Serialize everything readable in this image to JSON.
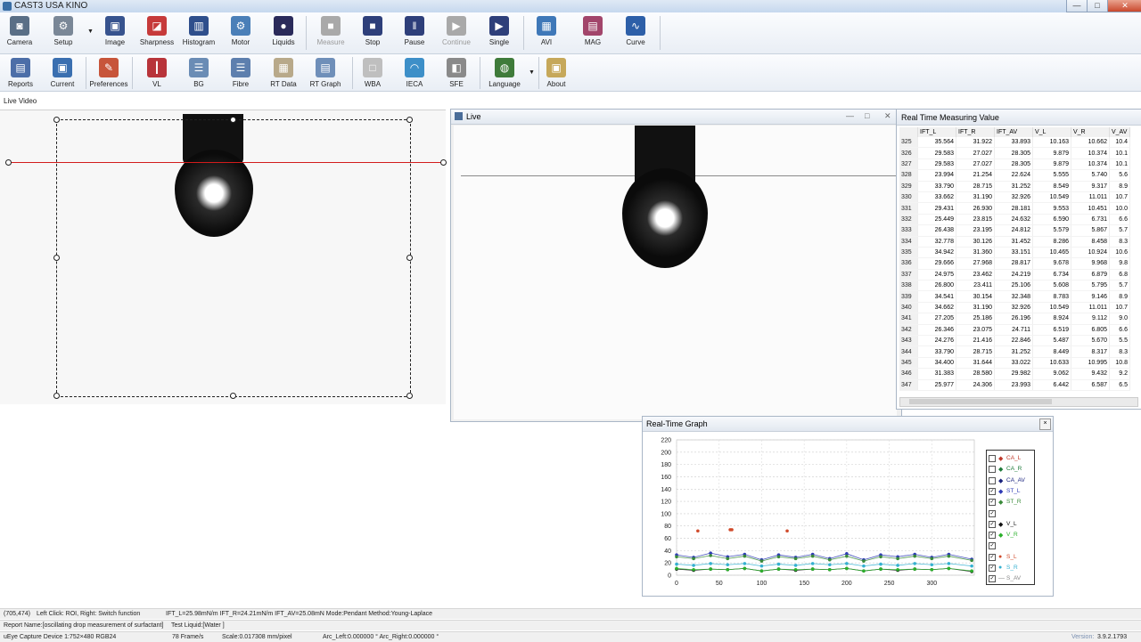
{
  "window": {
    "title": "CAST3  USA KINO",
    "controls": [
      "—",
      "□",
      "✕"
    ]
  },
  "toolbar1": {
    "items": [
      {
        "label": "Camera",
        "color": "#5a6f86",
        "glyph": "◙"
      },
      {
        "label": "Setup",
        "color": "#7a8797",
        "glyph": "⚙"
      },
      {
        "label": "Image",
        "color": "#37538e",
        "glyph": "▣"
      },
      {
        "label": "Sharpness",
        "color": "#c63a3a",
        "glyph": "◪"
      },
      {
        "label": "Histogram",
        "color": "#2f4f8c",
        "glyph": "▥"
      },
      {
        "label": "Motor",
        "color": "#4a7fb8",
        "glyph": "⚙"
      },
      {
        "label": "Liquids",
        "color": "#2a2a5a",
        "glyph": "●"
      },
      {
        "label": "Measure",
        "color": "#a9a9a9",
        "glyph": "■",
        "disabled": true
      },
      {
        "label": "Stop",
        "color": "#2e3f7a",
        "glyph": "■"
      },
      {
        "label": "Pause",
        "color": "#2e3f7a",
        "glyph": "‖"
      },
      {
        "label": "Continue",
        "color": "#a9a9a9",
        "glyph": "▶",
        "disabled": true
      },
      {
        "label": "Single",
        "color": "#2e3f7a",
        "glyph": "▶"
      },
      {
        "label": "AVI",
        "color": "#3f78b8",
        "glyph": "▦"
      },
      {
        "label": "MAG",
        "color": "#a2456b",
        "glyph": "▤"
      },
      {
        "label": "Curve",
        "color": "#2d5fa8",
        "glyph": "∿"
      }
    ]
  },
  "toolbar2": {
    "items": [
      {
        "label": "Reports",
        "color": "#4c6ea8",
        "glyph": "▤"
      },
      {
        "label": "Current",
        "color": "#3a6fb0",
        "glyph": "▣"
      },
      {
        "label": "Preferences",
        "color": "#c7553a",
        "glyph": "✎"
      },
      {
        "label": "VL",
        "color": "#b8343a",
        "glyph": "┃"
      },
      {
        "label": "BG",
        "color": "#6a8cb5",
        "glyph": "☰"
      },
      {
        "label": "Fibre",
        "color": "#5d7fae",
        "glyph": "☰"
      },
      {
        "label": "RT Data",
        "color": "#b8a98a",
        "glyph": "▦"
      },
      {
        "label": "RT Graph",
        "color": "#6f8fb9",
        "glyph": "▤"
      },
      {
        "label": "WBA",
        "color": "#bfbfbf",
        "glyph": "□"
      },
      {
        "label": "IECA",
        "color": "#3d8fc8",
        "glyph": "◠"
      },
      {
        "label": "SFE",
        "color": "#8a8a8a",
        "glyph": "◧"
      },
      {
        "label": "Language",
        "color": "#3f7b3a",
        "glyph": "◍"
      },
      {
        "label": "About",
        "color": "#c6a85a",
        "glyph": "▣"
      }
    ]
  },
  "live_video": {
    "label": "Live Video"
  },
  "live_window": {
    "title": "Live",
    "controls": [
      "—",
      "□",
      "✕"
    ]
  },
  "rt_table": {
    "title": "Real Time Measuring Value",
    "columns": [
      "",
      "IFT_L",
      "IFT_R",
      "IFT_AV",
      "V_L",
      "V_R",
      "V_AV"
    ],
    "rows": [
      [
        "325",
        "35.564",
        "31.922",
        "33.893",
        "10.163",
        "10.662",
        "10.4"
      ],
      [
        "326",
        "29.583",
        "27.027",
        "28.305",
        "9.879",
        "10.374",
        "10.1"
      ],
      [
        "327",
        "29.583",
        "27.027",
        "28.305",
        "9.879",
        "10.374",
        "10.1"
      ],
      [
        "328",
        "23.994",
        "21.254",
        "22.624",
        "5.555",
        "5.740",
        "5.6"
      ],
      [
        "329",
        "33.790",
        "28.715",
        "31.252",
        "8.549",
        "9.317",
        "8.9"
      ],
      [
        "330",
        "33.662",
        "31.190",
        "32.926",
        "10.549",
        "11.011",
        "10.7"
      ],
      [
        "331",
        "29.431",
        "26.930",
        "28.181",
        "9.553",
        "10.451",
        "10.0"
      ],
      [
        "332",
        "25.449",
        "23.815",
        "24.632",
        "6.590",
        "6.731",
        "6.6"
      ],
      [
        "333",
        "26.438",
        "23.195",
        "24.812",
        "5.579",
        "5.867",
        "5.7"
      ],
      [
        "334",
        "32.778",
        "30.126",
        "31.452",
        "8.286",
        "8.458",
        "8.3"
      ],
      [
        "335",
        "34.942",
        "31.360",
        "33.151",
        "10.465",
        "10.924",
        "10.6"
      ],
      [
        "336",
        "29.666",
        "27.968",
        "28.817",
        "9.678",
        "9.968",
        "9.8"
      ],
      [
        "337",
        "24.975",
        "23.462",
        "24.219",
        "6.734",
        "6.879",
        "6.8"
      ],
      [
        "338",
        "26.800",
        "23.411",
        "25.106",
        "5.608",
        "5.795",
        "5.7"
      ],
      [
        "339",
        "34.541",
        "30.154",
        "32.348",
        "8.783",
        "9.146",
        "8.9"
      ],
      [
        "340",
        "34.662",
        "31.190",
        "32.926",
        "10.549",
        "11.011",
        "10.7"
      ],
      [
        "341",
        "27.205",
        "25.186",
        "26.196",
        "8.924",
        "9.112",
        "9.0"
      ],
      [
        "342",
        "26.346",
        "23.075",
        "24.711",
        "6.519",
        "6.805",
        "6.6"
      ],
      [
        "343",
        "24.276",
        "21.416",
        "22.846",
        "5.487",
        "5.670",
        "5.5"
      ],
      [
        "344",
        "33.790",
        "28.715",
        "31.252",
        "8.449",
        "8.317",
        "8.3"
      ],
      [
        "345",
        "34.400",
        "31.644",
        "33.022",
        "10.633",
        "10.995",
        "10.8"
      ],
      [
        "346",
        "31.383",
        "28.580",
        "29.982",
        "9.062",
        "9.432",
        "9.2"
      ],
      [
        "347",
        "25.977",
        "24.306",
        "23.993",
        "6.442",
        "6.587",
        "6.5"
      ]
    ]
  },
  "rt_graph": {
    "title": "Real-Time Graph",
    "close": "×",
    "legend": [
      {
        "name": "CA_L",
        "checked": false,
        "marker": "◆",
        "color": "#c0392b"
      },
      {
        "name": "CA_R",
        "checked": false,
        "marker": "◆",
        "color": "#1e7a3a"
      },
      {
        "name": "CA_AV",
        "checked": false,
        "marker": "◆",
        "color": "#1a237e"
      },
      {
        "name": "ST_L",
        "checked": true,
        "marker": "◆",
        "color": "#2e3bb5"
      },
      {
        "name": "ST_R",
        "checked": true,
        "marker": "◆",
        "color": "#3a8a3a"
      },
      {
        "name": "",
        "checked": true,
        "marker": "",
        "color": "#888888"
      },
      {
        "name": "V_L",
        "checked": true,
        "marker": "◆",
        "color": "#111111"
      },
      {
        "name": "V_R",
        "checked": true,
        "marker": "◆",
        "color": "#2bb02b"
      },
      {
        "name": "",
        "checked": true,
        "marker": "",
        "color": "#888888"
      },
      {
        "name": "S_L",
        "checked": true,
        "marker": "●",
        "color": "#d04a2a"
      },
      {
        "name": "S_R",
        "checked": true,
        "marker": "●",
        "color": "#35b0d0"
      },
      {
        "name": "S_AV",
        "checked": true,
        "marker": "—",
        "color": "#888888"
      }
    ]
  },
  "chart_data": {
    "type": "scatter",
    "xlim": [
      0,
      350
    ],
    "ylim": [
      0,
      220
    ],
    "x_ticks": [
      "0",
      "50",
      "100",
      "150",
      "200",
      "250",
      "300"
    ],
    "y_ticks": [
      "0",
      "20",
      "40",
      "60",
      "80",
      "100",
      "120",
      "140",
      "160",
      "180",
      "200",
      "220"
    ],
    "grid": true,
    "series": [
      {
        "name": "V_L",
        "color": "#111111",
        "x": [
          0,
          20,
          40,
          60,
          80,
          100,
          120,
          140,
          160,
          180,
          200,
          220,
          240,
          260,
          280,
          300,
          320,
          347
        ],
        "y": [
          10,
          8,
          10,
          9,
          11,
          7,
          10,
          8,
          10,
          9,
          11,
          7,
          10,
          8,
          10,
          9,
          11,
          6
        ]
      },
      {
        "name": "V_R",
        "color": "#2bb02b",
        "x": [
          0,
          20,
          40,
          60,
          80,
          100,
          120,
          140,
          160,
          180,
          200,
          220,
          240,
          260,
          280,
          300,
          320,
          347
        ],
        "y": [
          11,
          9,
          10,
          9,
          11,
          7,
          10,
          9,
          10,
          9,
          11,
          7,
          10,
          9,
          10,
          9,
          11,
          7
        ]
      },
      {
        "name": "ST_L",
        "color": "#2e3bb5",
        "x": [
          0,
          20,
          40,
          60,
          80,
          100,
          120,
          140,
          160,
          180,
          200,
          220,
          240,
          260,
          280,
          300,
          320,
          347
        ],
        "y": [
          33,
          29,
          36,
          30,
          34,
          25,
          33,
          29,
          34,
          27,
          35,
          25,
          33,
          30,
          34,
          29,
          34,
          26
        ]
      },
      {
        "name": "ST_R",
        "color": "#3a8a3a",
        "x": [
          0,
          20,
          40,
          60,
          80,
          100,
          120,
          140,
          160,
          180,
          200,
          220,
          240,
          260,
          280,
          300,
          320,
          347
        ],
        "y": [
          30,
          27,
          32,
          27,
          31,
          23,
          30,
          27,
          31,
          25,
          31,
          23,
          30,
          27,
          31,
          27,
          31,
          24
        ]
      },
      {
        "name": "S_R",
        "color": "#35b0d0",
        "x": [
          0,
          20,
          40,
          60,
          80,
          100,
          120,
          140,
          160,
          180,
          200,
          220,
          240,
          260,
          280,
          300,
          320,
          347
        ],
        "y": [
          18,
          16,
          19,
          17,
          19,
          15,
          18,
          16,
          19,
          17,
          19,
          15,
          18,
          16,
          19,
          17,
          19,
          15
        ]
      },
      {
        "name": "S_L",
        "color": "#d04a2a",
        "x": [
          25,
          63,
          65,
          130
        ],
        "y": [
          72,
          74,
          74,
          72
        ]
      }
    ]
  },
  "status": {
    "coords": "(705,474)",
    "hint": "Left Click: ROI, Right: Switch function",
    "ift": "IFT_L=25.98mN/m IFT_R=24.21mN/m IFT_AV=25.08mN  Mode:Pendant  Method:Young-Laplace",
    "report": "Report Name:[oscillating drop measurement of surfactant]",
    "liquid": "Test Liquid:[Water ]",
    "device": "uEye Capture Device 1:752×480  RGB24",
    "fps": "78  Frame/s",
    "scale": "Scale:0.017308 mm/pixel",
    "arc": "Arc_Left:0.000000 °  Arc_Right:0.000000 °",
    "version_label": "Version:",
    "version": "3.9.2.1793"
  }
}
